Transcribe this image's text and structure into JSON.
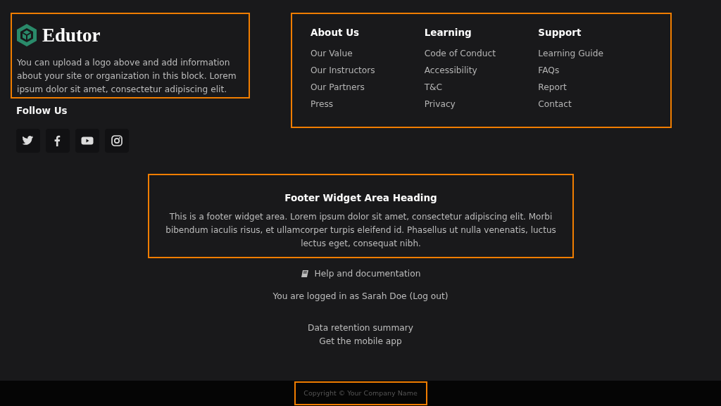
{
  "brand": {
    "name": "Edutor",
    "description": "You can upload a logo above and add information about your site or organization in this block. Lorem ipsum dolor sit amet, consectetur adipiscing elit."
  },
  "social": {
    "heading": "Follow Us",
    "links": [
      {
        "kind": "twitter"
      },
      {
        "kind": "facebook"
      },
      {
        "kind": "youtube"
      },
      {
        "kind": "instagram"
      }
    ]
  },
  "link_columns": [
    {
      "heading": "About Us",
      "links": [
        "Our Value",
        "Our Instructors",
        "Our Partners",
        "Press"
      ]
    },
    {
      "heading": "Learning",
      "links": [
        "Code of Conduct",
        "Accessibility",
        "T&C",
        "Privacy"
      ]
    },
    {
      "heading": "Support",
      "links": [
        "Learning Guide",
        "FAQs",
        "Report",
        "Contact"
      ]
    }
  ],
  "widget": {
    "heading": "Footer Widget Area Heading",
    "text": "This is a footer widget area. Lorem ipsum dolor sit amet, consectetur adipiscing elit. Morbi bibendum iaculis risus, et ullamcorper turpis eleifend id. Phasellus ut nulla venenatis, luctus lectus eget, consequat nibh."
  },
  "help_link": "Help and documentation",
  "login": {
    "prefix": "You are logged in as ",
    "user": "Sarah Doe",
    "logout": "(Log out)"
  },
  "extra_links": [
    "Data retention summary",
    "Get the mobile app"
  ],
  "copyright": "Copyright © Your Company Name"
}
